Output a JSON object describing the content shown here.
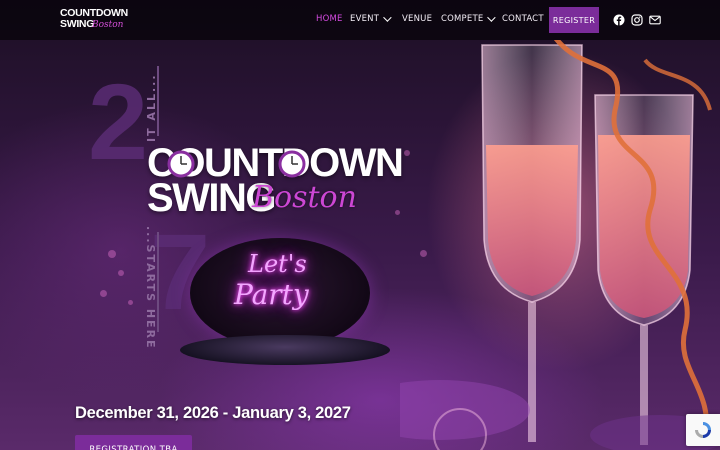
{
  "brand": {
    "logo_line1": "COUNTDOWN",
    "logo_line2": "SWING",
    "logo_script": "Boston"
  },
  "nav": {
    "items": [
      {
        "label": "HOME",
        "active": true,
        "has_dropdown": false
      },
      {
        "label": "EVENT",
        "active": false,
        "has_dropdown": true
      },
      {
        "label": "VENUE",
        "active": false,
        "has_dropdown": false
      },
      {
        "label": "COMPETE",
        "active": false,
        "has_dropdown": true
      },
      {
        "label": "CONTACT",
        "active": false,
        "has_dropdown": false
      }
    ],
    "register_label": "REGISTER",
    "social_icons": [
      "facebook-icon",
      "instagram-icon",
      "mail-icon"
    ]
  },
  "hero": {
    "countdown_top_number": "2",
    "countdown_top_text": "IT ALL...",
    "countdown_bottom_number": "7",
    "countdown_bottom_text": "...STARTS HERE",
    "title_line1": "COUNTDOWN",
    "title_line2": "SWING",
    "title_script": "Boston",
    "neon_line1": "Let's",
    "neon_line2": "Party",
    "dates": "December 31, 2026 - January 3, 2027",
    "cta_label": "REGISTRATION TBA"
  },
  "colors": {
    "accent": "#d44be0",
    "button": "#7b2c9a",
    "nav_bg": "#0a050e"
  }
}
